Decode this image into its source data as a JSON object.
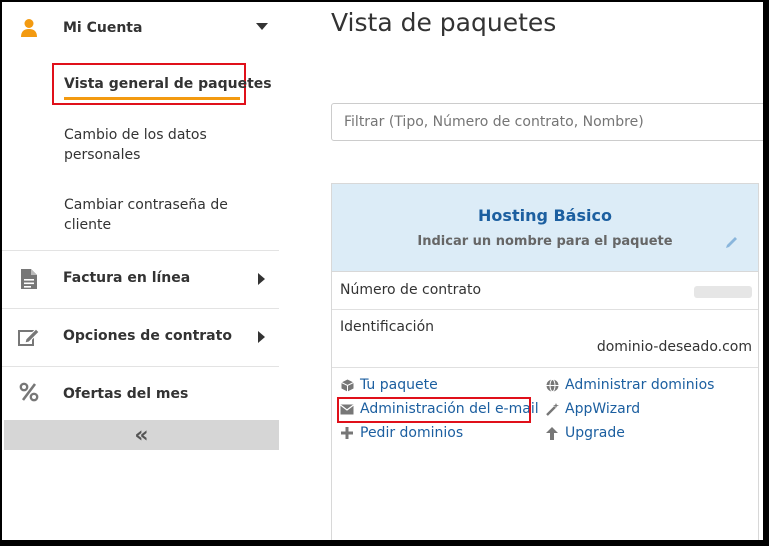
{
  "sidebar": {
    "account": {
      "label": "Mi Cuenta",
      "icon": "user-icon"
    },
    "sub_items": [
      {
        "label": "Vista general de paquetes",
        "active": true
      },
      {
        "label": "Cambio de los datos personales"
      },
      {
        "label": "Cambiar contraseña de cliente"
      }
    ],
    "nav": [
      {
        "label": "Factura en línea",
        "icon": "document-icon"
      },
      {
        "label": "Opciones de contrato",
        "icon": "edit-icon"
      },
      {
        "label": "Ofertas del mes",
        "icon": "percent-icon"
      }
    ],
    "collapse_glyph": "«"
  },
  "main": {
    "title": "Vista de paquetes",
    "filter_placeholder": "Filtrar (Tipo, Número de contrato, Nombre)",
    "package": {
      "title": "Hosting Básico",
      "subtitle": "Indicar un nombre para el paquete",
      "contract_label": "Número de contrato",
      "identification_label": "Identificación",
      "identification_value": "dominio-deseado.com",
      "links_left": [
        {
          "label": "Tu paquete",
          "icon": "cube-icon"
        },
        {
          "label": "Administración del e-mail",
          "icon": "envelope-icon"
        },
        {
          "label": "Pedir dominios",
          "icon": "plus-icon"
        }
      ],
      "links_right": [
        {
          "label": "Administrar dominios",
          "icon": "globe-icon"
        },
        {
          "label": "AppWizard",
          "icon": "magic-wand-icon"
        },
        {
          "label": "Upgrade",
          "icon": "arrow-up-icon"
        }
      ]
    }
  },
  "colors": {
    "accent_orange": "#f39a10",
    "link_blue": "#1c5fa0",
    "highlight_red": "#e0101a",
    "card_header": "#dcecf7"
  }
}
